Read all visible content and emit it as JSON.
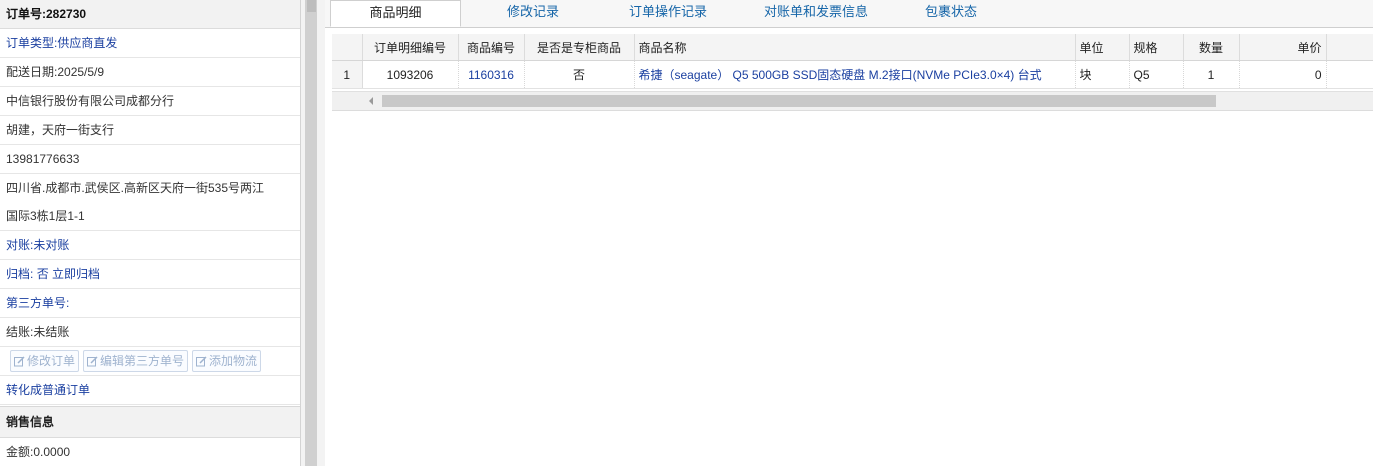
{
  "order": {
    "title_label": "订单号:",
    "order_no": "282730",
    "type_label": "订单类型:",
    "type_value": "供应商直发",
    "delivery_label": "配送日期:",
    "delivery_value": "2025/5/9",
    "customer": "中信银行股份有限公司成都分行",
    "contact": "胡建，天府一街支行",
    "phone": "13981776633",
    "address_line1": "四川省.成都市.武侯区.高新区天府一街535号两江",
    "address_line2": "国际3栋1层1-1",
    "recon_label": "对账:",
    "recon_value": "未对账",
    "archive_label": "归档:",
    "archive_value": "否 立即归档",
    "third_party_label": "第三方单号:",
    "settle_label": "结账:",
    "settle_value": "未结账",
    "btn_edit_order": "修改订单",
    "btn_edit_third": "编辑第三方单号",
    "btn_add_logistics": "添加物流",
    "convert_link": "转化成普通订单",
    "sales_section": "销售信息",
    "amount_label": "金额:",
    "amount_value": "0.0000"
  },
  "tabs": [
    "商品明细",
    "修改记录",
    "订单操作记录",
    "对账单和发票信息",
    "包裹状态"
  ],
  "grid": {
    "headers": [
      "订单明细编号",
      "商品编号",
      "是否是专柜商品",
      "商品名称",
      "单位",
      "规格",
      "数量",
      "单价"
    ],
    "rows": [
      {
        "rownum": "1",
        "detail_id": "1093206",
        "product_id": "1160316",
        "counter": "否",
        "name": "希捷（seagate） Q5 500GB SSD固态硬盘 M.2接口(NVMe PCIe3.0×4) 台式",
        "unit": "块",
        "spec": "Q5",
        "qty": "1",
        "price": "0"
      }
    ]
  },
  "icons": {
    "edit": "edit-icon",
    "scroll_left": "arrow-left-icon"
  },
  "colors": {
    "link_blue": "#1a3fa0",
    "tab_blue": "#1565a8",
    "disabled_btn": "#9fb3cf"
  }
}
